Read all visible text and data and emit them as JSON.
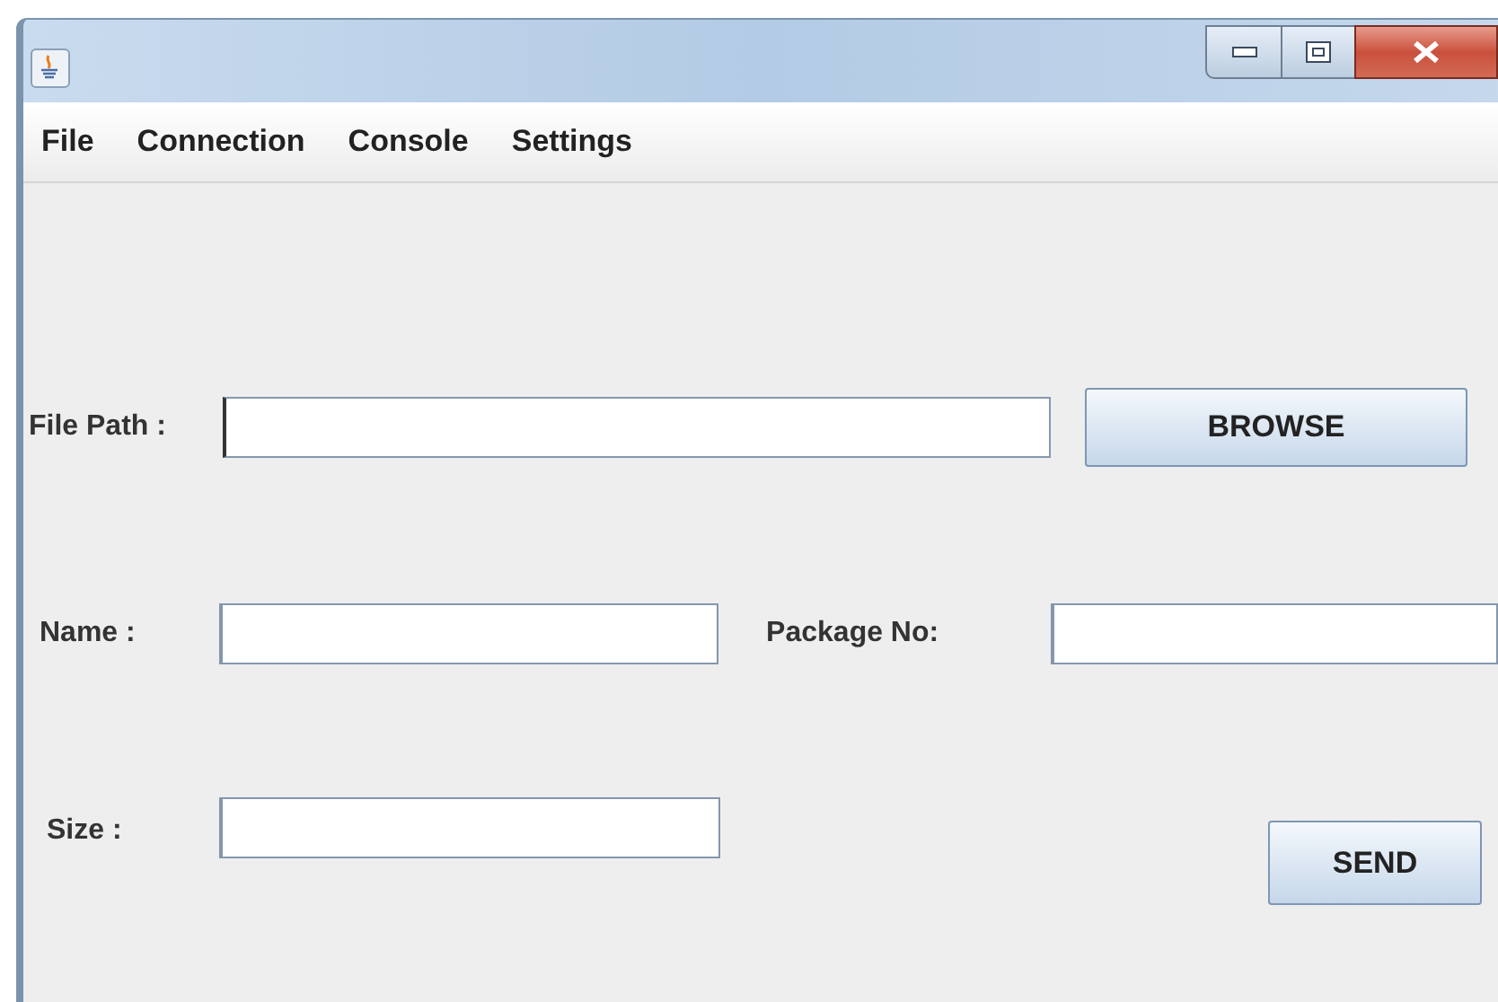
{
  "menu": [
    "File",
    "Connection",
    "Console",
    "Settings"
  ],
  "form": {
    "file_path": {
      "label": "File Path :",
      "button": "BROWSE"
    },
    "name": {
      "label": "Name :"
    },
    "package_no": {
      "label": "Package No:"
    },
    "size": {
      "label": "Size :"
    },
    "send_button": "SEND"
  }
}
